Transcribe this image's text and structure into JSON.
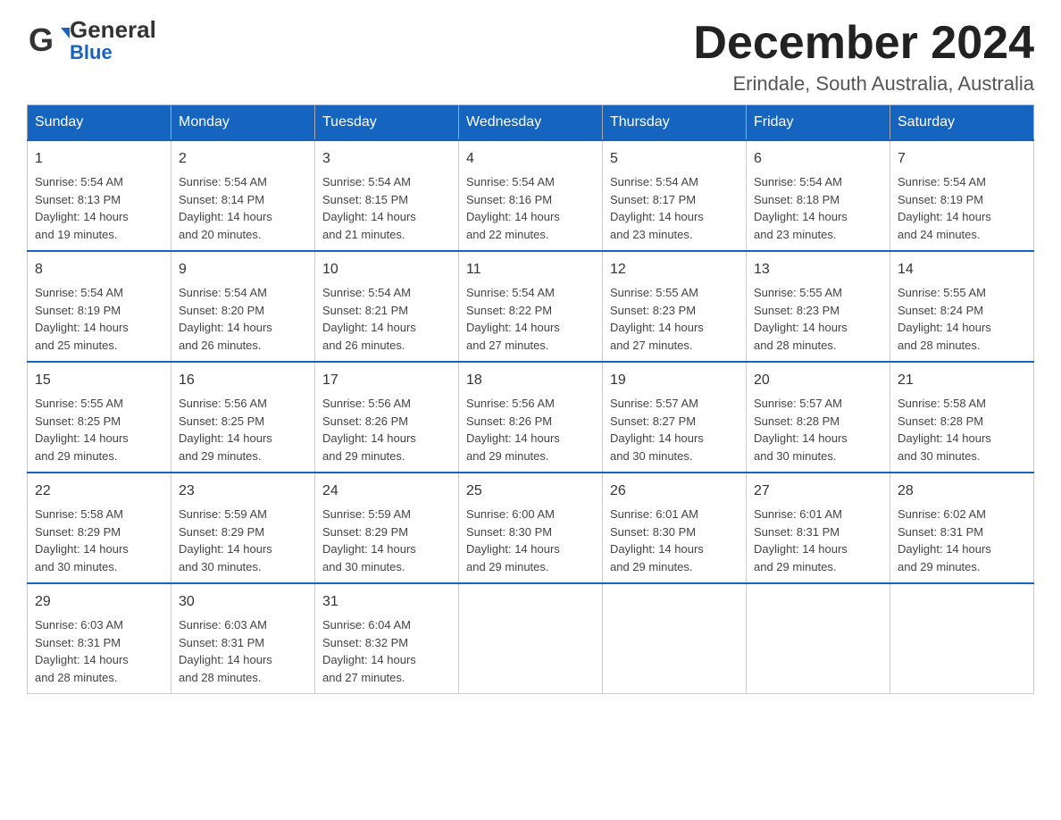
{
  "header": {
    "logo_general": "General",
    "logo_blue": "Blue",
    "month_title": "December 2024",
    "location": "Erindale, South Australia, Australia"
  },
  "weekdays": [
    "Sunday",
    "Monday",
    "Tuesday",
    "Wednesday",
    "Thursday",
    "Friday",
    "Saturday"
  ],
  "weeks": [
    [
      {
        "day": "1",
        "sunrise": "5:54 AM",
        "sunset": "8:13 PM",
        "daylight": "14 hours and 19 minutes."
      },
      {
        "day": "2",
        "sunrise": "5:54 AM",
        "sunset": "8:14 PM",
        "daylight": "14 hours and 20 minutes."
      },
      {
        "day": "3",
        "sunrise": "5:54 AM",
        "sunset": "8:15 PM",
        "daylight": "14 hours and 21 minutes."
      },
      {
        "day": "4",
        "sunrise": "5:54 AM",
        "sunset": "8:16 PM",
        "daylight": "14 hours and 22 minutes."
      },
      {
        "day": "5",
        "sunrise": "5:54 AM",
        "sunset": "8:17 PM",
        "daylight": "14 hours and 23 minutes."
      },
      {
        "day": "6",
        "sunrise": "5:54 AM",
        "sunset": "8:18 PM",
        "daylight": "14 hours and 23 minutes."
      },
      {
        "day": "7",
        "sunrise": "5:54 AM",
        "sunset": "8:19 PM",
        "daylight": "14 hours and 24 minutes."
      }
    ],
    [
      {
        "day": "8",
        "sunrise": "5:54 AM",
        "sunset": "8:19 PM",
        "daylight": "14 hours and 25 minutes."
      },
      {
        "day": "9",
        "sunrise": "5:54 AM",
        "sunset": "8:20 PM",
        "daylight": "14 hours and 26 minutes."
      },
      {
        "day": "10",
        "sunrise": "5:54 AM",
        "sunset": "8:21 PM",
        "daylight": "14 hours and 26 minutes."
      },
      {
        "day": "11",
        "sunrise": "5:54 AM",
        "sunset": "8:22 PM",
        "daylight": "14 hours and 27 minutes."
      },
      {
        "day": "12",
        "sunrise": "5:55 AM",
        "sunset": "8:23 PM",
        "daylight": "14 hours and 27 minutes."
      },
      {
        "day": "13",
        "sunrise": "5:55 AM",
        "sunset": "8:23 PM",
        "daylight": "14 hours and 28 minutes."
      },
      {
        "day": "14",
        "sunrise": "5:55 AM",
        "sunset": "8:24 PM",
        "daylight": "14 hours and 28 minutes."
      }
    ],
    [
      {
        "day": "15",
        "sunrise": "5:55 AM",
        "sunset": "8:25 PM",
        "daylight": "14 hours and 29 minutes."
      },
      {
        "day": "16",
        "sunrise": "5:56 AM",
        "sunset": "8:25 PM",
        "daylight": "14 hours and 29 minutes."
      },
      {
        "day": "17",
        "sunrise": "5:56 AM",
        "sunset": "8:26 PM",
        "daylight": "14 hours and 29 minutes."
      },
      {
        "day": "18",
        "sunrise": "5:56 AM",
        "sunset": "8:26 PM",
        "daylight": "14 hours and 29 minutes."
      },
      {
        "day": "19",
        "sunrise": "5:57 AM",
        "sunset": "8:27 PM",
        "daylight": "14 hours and 30 minutes."
      },
      {
        "day": "20",
        "sunrise": "5:57 AM",
        "sunset": "8:28 PM",
        "daylight": "14 hours and 30 minutes."
      },
      {
        "day": "21",
        "sunrise": "5:58 AM",
        "sunset": "8:28 PM",
        "daylight": "14 hours and 30 minutes."
      }
    ],
    [
      {
        "day": "22",
        "sunrise": "5:58 AM",
        "sunset": "8:29 PM",
        "daylight": "14 hours and 30 minutes."
      },
      {
        "day": "23",
        "sunrise": "5:59 AM",
        "sunset": "8:29 PM",
        "daylight": "14 hours and 30 minutes."
      },
      {
        "day": "24",
        "sunrise": "5:59 AM",
        "sunset": "8:29 PM",
        "daylight": "14 hours and 30 minutes."
      },
      {
        "day": "25",
        "sunrise": "6:00 AM",
        "sunset": "8:30 PM",
        "daylight": "14 hours and 29 minutes."
      },
      {
        "day": "26",
        "sunrise": "6:01 AM",
        "sunset": "8:30 PM",
        "daylight": "14 hours and 29 minutes."
      },
      {
        "day": "27",
        "sunrise": "6:01 AM",
        "sunset": "8:31 PM",
        "daylight": "14 hours and 29 minutes."
      },
      {
        "day": "28",
        "sunrise": "6:02 AM",
        "sunset": "8:31 PM",
        "daylight": "14 hours and 29 minutes."
      }
    ],
    [
      {
        "day": "29",
        "sunrise": "6:03 AM",
        "sunset": "8:31 PM",
        "daylight": "14 hours and 28 minutes."
      },
      {
        "day": "30",
        "sunrise": "6:03 AM",
        "sunset": "8:31 PM",
        "daylight": "14 hours and 28 minutes."
      },
      {
        "day": "31",
        "sunrise": "6:04 AM",
        "sunset": "8:32 PM",
        "daylight": "14 hours and 27 minutes."
      },
      null,
      null,
      null,
      null
    ]
  ],
  "labels": {
    "sunrise": "Sunrise:",
    "sunset": "Sunset:",
    "daylight": "Daylight:"
  }
}
